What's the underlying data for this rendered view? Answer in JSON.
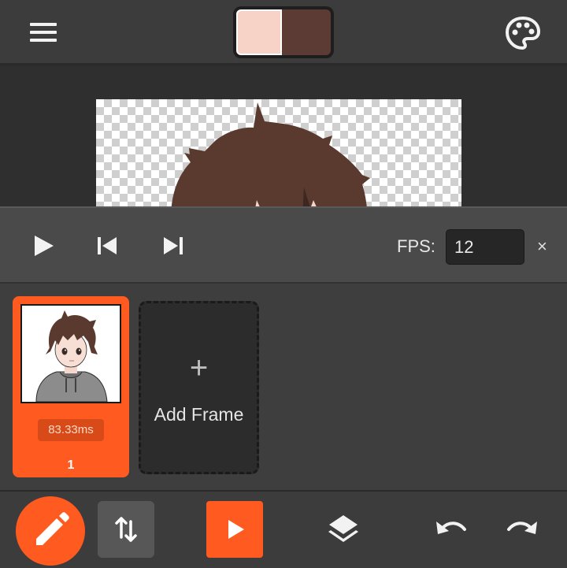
{
  "colors": {
    "primary": "#f7d3c7",
    "secondary": "#5b3b33",
    "accent": "#ff5a1f",
    "hair": "#5a3a2e"
  },
  "topbar": {
    "menu_icon": "hamburger-menu-icon",
    "palette_icon": "palette-icon"
  },
  "playback": {
    "play_icon": "play-icon",
    "prev_icon": "skip-previous-icon",
    "next_icon": "skip-next-icon",
    "fps_label": "FPS:",
    "fps_value": "12",
    "close_label": "×"
  },
  "frames": [
    {
      "duration": "83.33ms",
      "number": "1",
      "selected": true
    }
  ],
  "add_frame": {
    "plus": "+",
    "label": "Add Frame"
  },
  "toolbar": {
    "pencil_icon": "pencil-icon",
    "swap_icon": "swap-vertical-icon",
    "play_icon": "play-icon",
    "layers_icon": "layers-icon",
    "undo_icon": "undo-icon",
    "redo_icon": "redo-icon"
  }
}
